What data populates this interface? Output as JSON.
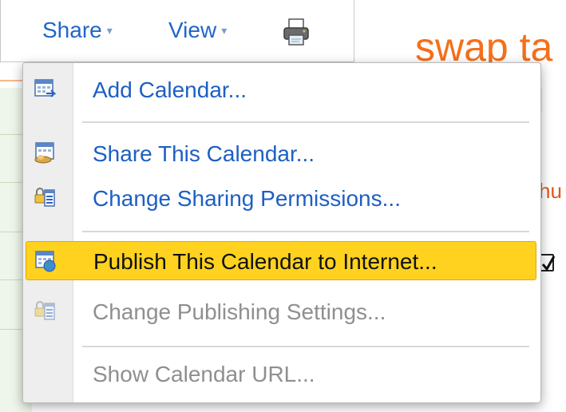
{
  "toolbar": {
    "share_label": "Share",
    "view_label": "View",
    "dropdown_caret": "▾",
    "print_icon": "printer-icon"
  },
  "background": {
    "title_fragment": "swap ta",
    "text_fragment": "hu",
    "checkbox_checked": true
  },
  "share_menu": {
    "items": [
      {
        "label": "Add Calendar...",
        "icon": "add-calendar-icon",
        "enabled": true,
        "highlighted": false
      },
      {
        "label": "Share This Calendar...",
        "icon": "share-calendar-icon",
        "enabled": true,
        "highlighted": false
      },
      {
        "label": "Change Sharing Permissions...",
        "icon": "sharing-permissions-icon",
        "enabled": true,
        "highlighted": false
      },
      {
        "label": "Publish This Calendar to Internet...",
        "icon": "publish-calendar-icon",
        "enabled": true,
        "highlighted": true
      },
      {
        "label": "Change Publishing Settings...",
        "icon": "publishing-settings-icon",
        "enabled": false,
        "highlighted": false
      },
      {
        "label": "Show Calendar URL...",
        "icon": "",
        "enabled": false,
        "highlighted": false
      }
    ]
  },
  "colors": {
    "link_blue": "#1d5fc4",
    "highlight_yellow": "#ffd21f",
    "disabled_gray": "#8f8f8f",
    "brand_orange": "#f5701a"
  }
}
